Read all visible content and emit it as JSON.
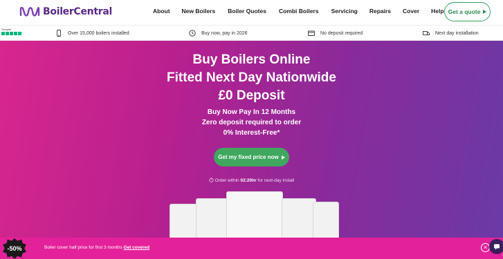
{
  "brand": {
    "name": "BoilerCentral",
    "color": "#5b2a86"
  },
  "nav": {
    "items": [
      "About",
      "New Boilers",
      "Boiler Quotes",
      "Combi Boilers",
      "Servicing",
      "Repairs",
      "Cover",
      "Help"
    ],
    "cta_label": "Get a quote"
  },
  "trust": {
    "trustpilot_label": "Trustpilot",
    "items": [
      {
        "icon": "phone-icon",
        "text": "Over 15,000 boilers installed"
      },
      {
        "icon": "clock-icon",
        "text": "Buy now, pay in 2026"
      },
      {
        "icon": "card-icon",
        "text": "No deposit required"
      },
      {
        "icon": "van-icon",
        "text": "Next day installation"
      }
    ]
  },
  "hero": {
    "headline": [
      "Buy Boilers Online",
      "Fitted Next Day Nationwide",
      "£0 Deposit"
    ],
    "sublines": [
      "Buy Now Pay In 12 Months",
      "Zero deposit required to order",
      "0% Interest-Free*"
    ],
    "cta_label": "Get my fixed price now",
    "timer_prefix": "Order within",
    "timer_value": "02:20hr",
    "timer_suffix": "for next-day install"
  },
  "promo": {
    "badge": "-50%",
    "text": "Boiler cover half price for first 3 months",
    "link": "Get covered"
  },
  "colors": {
    "accent_green": "#3fa75e",
    "hero_pink": "#d8268e",
    "hero_purple": "#6a3aa6",
    "promo_pink": "#e3219a"
  }
}
